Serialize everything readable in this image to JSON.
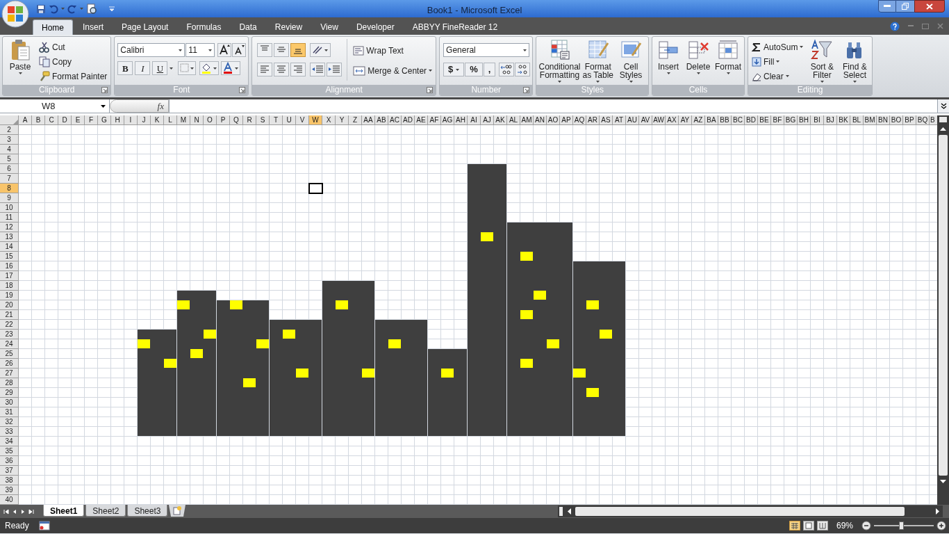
{
  "window": {
    "title": "Book1 - Microsoft Excel"
  },
  "ribbon_tabs": [
    {
      "label": "Home",
      "selected": true
    },
    {
      "label": "Insert",
      "selected": false
    },
    {
      "label": "Page Layout",
      "selected": false
    },
    {
      "label": "Formulas",
      "selected": false
    },
    {
      "label": "Data",
      "selected": false
    },
    {
      "label": "Review",
      "selected": false
    },
    {
      "label": "View",
      "selected": false
    },
    {
      "label": "Developer",
      "selected": false
    },
    {
      "label": "ABBYY FineReader 12",
      "selected": false
    }
  ],
  "clipboard": {
    "label": "Clipboard",
    "paste": "Paste",
    "items": [
      "Cut",
      "Copy",
      "Format Painter"
    ]
  },
  "font": {
    "label": "Font",
    "font_name": "Calibri",
    "font_size": "11",
    "bold": "B",
    "italic": "I",
    "underline": "U"
  },
  "alignment": {
    "label": "Alignment",
    "vertical_align": [
      {
        "selected": false
      },
      {
        "selected": false
      },
      {
        "selected": true
      }
    ],
    "wrap_text": "Wrap Text",
    "merge_center": "Merge & Center"
  },
  "number": {
    "label": "Number",
    "format": "General",
    "buttons": [
      "$",
      "%",
      ","
    ]
  },
  "styles": {
    "label": "Styles",
    "buttons": [
      "Conditional\nFormatting",
      "Format\nas Table",
      "Cell\nStyles"
    ]
  },
  "cells": {
    "label": "Cells",
    "buttons": [
      "Insert",
      "Delete",
      "Format"
    ]
  },
  "editing": {
    "label": "Editing",
    "items": [
      "AutoSum",
      "Fill",
      "Clear"
    ],
    "buttons": [
      "Sort &\nFilter",
      "Find &\nSelect"
    ]
  },
  "formula_bar": {
    "name_box": "W8",
    "function_label": "fx"
  },
  "columns": [
    {
      "label": "A",
      "selected": false
    },
    {
      "label": "B",
      "selected": false
    },
    {
      "label": "C",
      "selected": false
    },
    {
      "label": "D",
      "selected": false
    },
    {
      "label": "E",
      "selected": false
    },
    {
      "label": "F",
      "selected": false
    },
    {
      "label": "G",
      "selected": false
    },
    {
      "label": "H",
      "selected": false
    },
    {
      "label": "I",
      "selected": false
    },
    {
      "label": "J",
      "selected": false
    },
    {
      "label": "K",
      "selected": false
    },
    {
      "label": "L",
      "selected": false
    },
    {
      "label": "M",
      "selected": false
    },
    {
      "label": "N",
      "selected": false
    },
    {
      "label": "O",
      "selected": false
    },
    {
      "label": "P",
      "selected": false
    },
    {
      "label": "Q",
      "selected": false
    },
    {
      "label": "R",
      "selected": false
    },
    {
      "label": "S",
      "selected": false
    },
    {
      "label": "T",
      "selected": false
    },
    {
      "label": "U",
      "selected": false
    },
    {
      "label": "V",
      "selected": false
    },
    {
      "label": "W",
      "selected": true
    },
    {
      "label": "X",
      "selected": false
    },
    {
      "label": "Y",
      "selected": false
    },
    {
      "label": "Z",
      "selected": false
    },
    {
      "label": "AA",
      "selected": false
    },
    {
      "label": "AB",
      "selected": false
    },
    {
      "label": "AC",
      "selected": false
    },
    {
      "label": "AD",
      "selected": false
    },
    {
      "label": "AE",
      "selected": false
    },
    {
      "label": "AF",
      "selected": false
    },
    {
      "label": "AG",
      "selected": false
    },
    {
      "label": "AH",
      "selected": false
    },
    {
      "label": "AI",
      "selected": false
    },
    {
      "label": "AJ",
      "selected": false
    },
    {
      "label": "AK",
      "selected": false
    },
    {
      "label": "AL",
      "selected": false
    },
    {
      "label": "AM",
      "selected": false
    },
    {
      "label": "AN",
      "selected": false
    },
    {
      "label": "AO",
      "selected": false
    },
    {
      "label": "AP",
      "selected": false
    },
    {
      "label": "AQ",
      "selected": false
    },
    {
      "label": "AR",
      "selected": false
    },
    {
      "label": "AS",
      "selected": false
    },
    {
      "label": "AT",
      "selected": false
    },
    {
      "label": "AU",
      "selected": false
    },
    {
      "label": "AV",
      "selected": false
    },
    {
      "label": "AW",
      "selected": false
    },
    {
      "label": "AX",
      "selected": false
    },
    {
      "label": "AY",
      "selected": false
    },
    {
      "label": "AZ",
      "selected": false
    },
    {
      "label": "BA",
      "selected": false
    },
    {
      "label": "BB",
      "selected": false
    },
    {
      "label": "BC",
      "selected": false
    },
    {
      "label": "BD",
      "selected": false
    },
    {
      "label": "BE",
      "selected": false
    },
    {
      "label": "BF",
      "selected": false
    },
    {
      "label": "BG",
      "selected": false
    },
    {
      "label": "BH",
      "selected": false
    },
    {
      "label": "BI",
      "selected": false
    },
    {
      "label": "BJ",
      "selected": false
    },
    {
      "label": "BK",
      "selected": false
    },
    {
      "label": "BL",
      "selected": false
    },
    {
      "label": "BM",
      "selected": false
    },
    {
      "label": "BN",
      "selected": false
    },
    {
      "label": "BO",
      "selected": false
    },
    {
      "label": "BP",
      "selected": false
    },
    {
      "label": "BQ",
      "selected": false
    },
    {
      "label": "B",
      "selected": false
    }
  ],
  "rows": [
    {
      "label": "2",
      "selected": false
    },
    {
      "label": "3",
      "selected": false
    },
    {
      "label": "4",
      "selected": false
    },
    {
      "label": "5",
      "selected": false
    },
    {
      "label": "6",
      "selected": false
    },
    {
      "label": "7",
      "selected": false
    },
    {
      "label": "8",
      "selected": true
    },
    {
      "label": "9",
      "selected": false
    },
    {
      "label": "10",
      "selected": false
    },
    {
      "label": "11",
      "selected": false
    },
    {
      "label": "12",
      "selected": false
    },
    {
      "label": "13",
      "selected": false
    },
    {
      "label": "14",
      "selected": false
    },
    {
      "label": "15",
      "selected": false
    },
    {
      "label": "16",
      "selected": false
    },
    {
      "label": "17",
      "selected": false
    },
    {
      "label": "18",
      "selected": false
    },
    {
      "label": "19",
      "selected": false
    },
    {
      "label": "20",
      "selected": false
    },
    {
      "label": "21",
      "selected": false
    },
    {
      "label": "22",
      "selected": false
    },
    {
      "label": "23",
      "selected": false
    },
    {
      "label": "24",
      "selected": false
    },
    {
      "label": "25",
      "selected": false
    },
    {
      "label": "26",
      "selected": false
    },
    {
      "label": "27",
      "selected": false
    },
    {
      "label": "28",
      "selected": false
    },
    {
      "label": "29",
      "selected": false
    },
    {
      "label": "30",
      "selected": false
    },
    {
      "label": "31",
      "selected": false
    },
    {
      "label": "32",
      "selected": false
    },
    {
      "label": "33",
      "selected": false
    },
    {
      "label": "34",
      "selected": false
    },
    {
      "label": "35",
      "selected": false
    },
    {
      "label": "36",
      "selected": false
    },
    {
      "label": "37",
      "selected": false
    },
    {
      "label": "38",
      "selected": false
    },
    {
      "label": "39",
      "selected": false
    },
    {
      "label": "40",
      "selected": false
    }
  ],
  "sheet_tabs": [
    {
      "label": "Sheet1",
      "selected": true
    },
    {
      "label": "Sheet2",
      "selected": false
    },
    {
      "label": "Sheet3",
      "selected": false
    }
  ],
  "status_bar": {
    "status": "Ready",
    "zoom": {
      "label": "69%",
      "level": 0.45
    }
  }
}
